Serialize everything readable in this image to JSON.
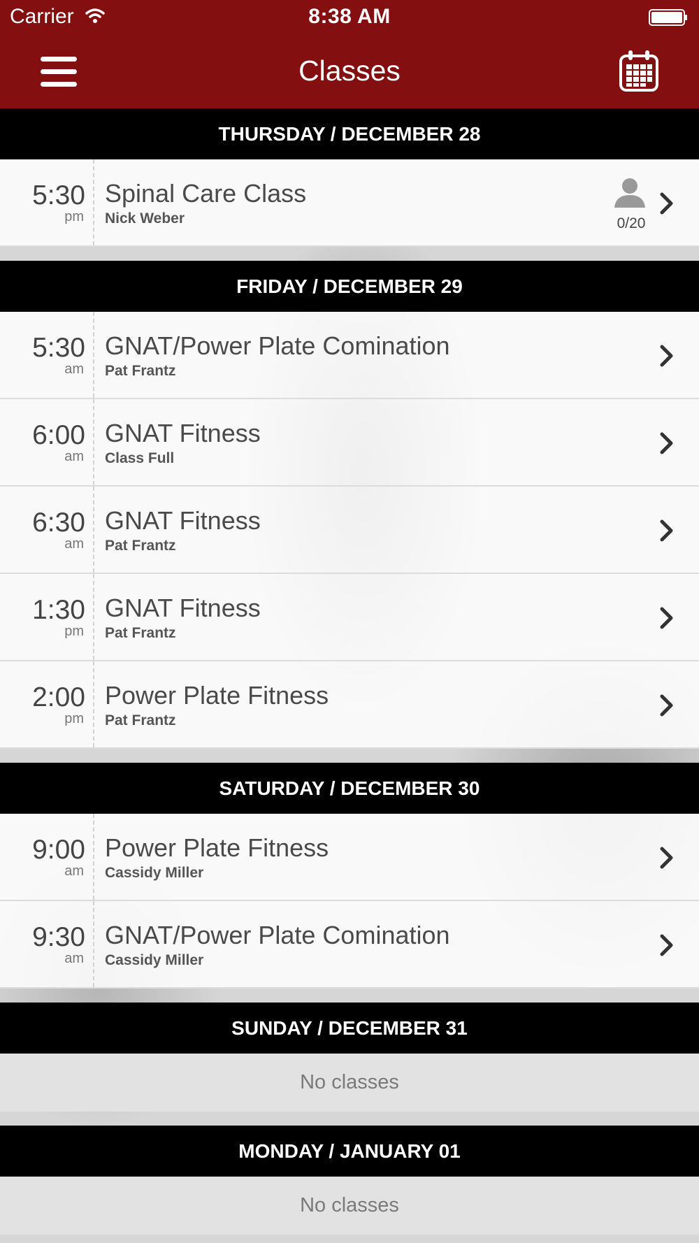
{
  "status_bar": {
    "carrier": "Carrier",
    "time": "8:38 AM"
  },
  "header": {
    "title": "Classes",
    "menu_icon": "menu-icon",
    "calendar_icon": "calendar-icon"
  },
  "days": [
    {
      "label": "THURSDAY / DECEMBER 28",
      "classes": [
        {
          "time": "5:30",
          "ampm": "pm",
          "name": "Spinal Care Class",
          "instructor": "Nick Weber",
          "capacity": "0/20"
        }
      ]
    },
    {
      "label": "FRIDAY / DECEMBER 29",
      "classes": [
        {
          "time": "5:30",
          "ampm": "am",
          "name": "GNAT/Power Plate Comination",
          "instructor": "Pat Frantz"
        },
        {
          "time": "6:00",
          "ampm": "am",
          "name": "GNAT Fitness",
          "instructor": "Class Full"
        },
        {
          "time": "6:30",
          "ampm": "am",
          "name": "GNAT Fitness",
          "instructor": "Pat Frantz"
        },
        {
          "time": "1:30",
          "ampm": "pm",
          "name": "GNAT Fitness",
          "instructor": "Pat Frantz"
        },
        {
          "time": "2:00",
          "ampm": "pm",
          "name": "Power Plate Fitness",
          "instructor": "Pat Frantz"
        }
      ]
    },
    {
      "label": "SATURDAY / DECEMBER 30",
      "classes": [
        {
          "time": "9:00",
          "ampm": "am",
          "name": "Power Plate Fitness",
          "instructor": "Cassidy Miller"
        },
        {
          "time": "9:30",
          "ampm": "am",
          "name": "GNAT/Power Plate Comination",
          "instructor": "Cassidy Miller"
        }
      ]
    },
    {
      "label": "SUNDAY / DECEMBER 31",
      "empty_text": "No classes"
    },
    {
      "label": "MONDAY / JANUARY 01",
      "empty_text": "No classes"
    }
  ]
}
